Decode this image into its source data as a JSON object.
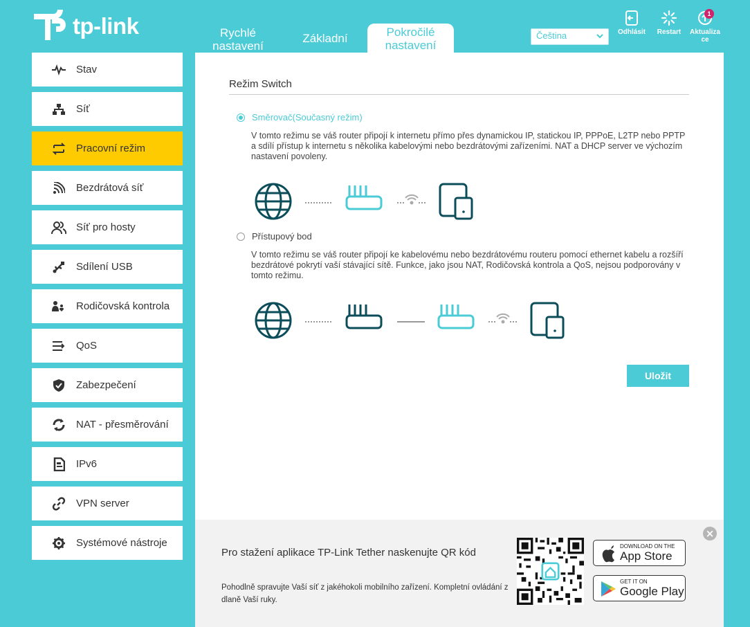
{
  "brand": {
    "logo_text": "tp-link"
  },
  "tabs": [
    {
      "label": "Rychlé nastavení"
    },
    {
      "label": "Základní"
    },
    {
      "label": "Pokročilé nastavení"
    }
  ],
  "language": {
    "selected": "Čeština"
  },
  "header_buttons": {
    "logout": "Odhlásit",
    "restart": "Restart",
    "update": "Aktualiza ce",
    "update_badge": "1"
  },
  "sidebar": {
    "items": [
      {
        "label": "Stav",
        "icon": "activity-icon"
      },
      {
        "label": "Síť",
        "icon": "network-icon"
      },
      {
        "label": "Pracovní režim",
        "icon": "switch-arrows-icon",
        "active": true
      },
      {
        "label": "Bezdrátová síť",
        "icon": "wireless-icon"
      },
      {
        "label": "Síť pro hosty",
        "icon": "guests-icon"
      },
      {
        "label": "Sdílení USB",
        "icon": "usb-icon"
      },
      {
        "label": "Rodičovská kontrola",
        "icon": "parental-icon"
      },
      {
        "label": "QoS",
        "icon": "qos-icon"
      },
      {
        "label": "Zabezpečení",
        "icon": "shield-icon"
      },
      {
        "label": "NAT - přesměrování",
        "icon": "nat-icon"
      },
      {
        "label": "IPv6",
        "icon": "ipv6-icon"
      },
      {
        "label": "VPN server",
        "icon": "vpn-link-icon"
      },
      {
        "label": "Systémové nástroje",
        "icon": "gear-icon"
      }
    ]
  },
  "main": {
    "section_title": "Režim Switch",
    "modes": [
      {
        "label": "Směrovač(Současný režim)",
        "selected": true,
        "description": "V tomto režimu se váš router připojí k internetu přímo přes dynamickou IP, statickou IP, PPPoE, L2TP nebo PPTP a sdílí přístup k internetu s několika kabelovými nebo bezdrátovými zařízeními. NAT a DHCP server ve výchozím nastavení povoleny."
      },
      {
        "label": "Přístupový bod",
        "selected": false,
        "description": "V tomto režimu se váš router připojí ke kabelovému nebo bezdrátovému routeru pomocí ethernet kabelu a rozšíří bezdrátové pokrytí vaší stávající sítě. Funkce, jako jsou NAT, Rodičovská kontrola a QoS, nejsou podporovány v tomto režimu."
      }
    ],
    "save_label": "Uložit"
  },
  "footer": {
    "title": "Pro stažení aplikace TP-Link Tether naskenujte QR kód",
    "subtitle": "Pohodlně spravujte Vaší síť z jakéhokoli mobilního zařízení. Kompletní ovládání z dlaně Vaší ruky.",
    "app_store_small": "DOWNLOAD ON THE",
    "app_store_big": "App Store",
    "google_small": "GET IT ON",
    "google_big": "Google Play",
    "close": "×"
  },
  "colors": {
    "accent": "#4acbd6",
    "active": "#fecb00",
    "dark_teal": "#0b4e5a",
    "badge": "#d0246a"
  }
}
